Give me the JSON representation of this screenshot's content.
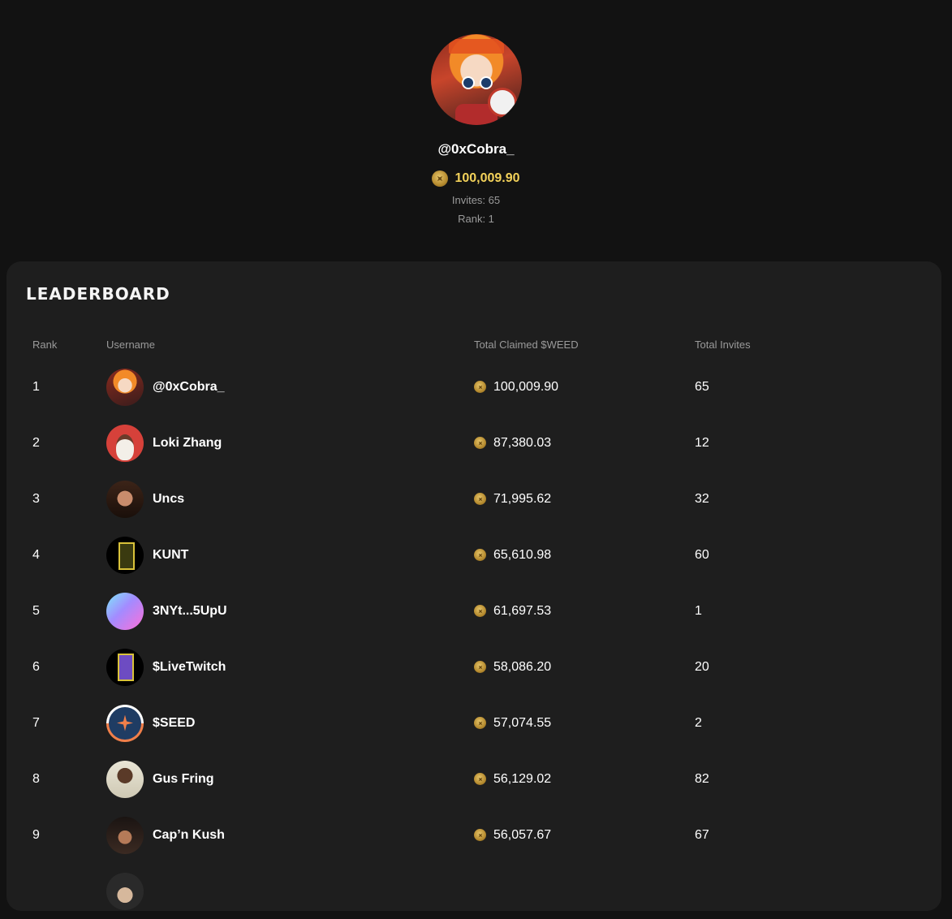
{
  "profile": {
    "username": "@0xCobra_",
    "balance": "100,009.90",
    "invites": "Invites: 65",
    "rank": "Rank: 1",
    "avatar_icon": "anime-girl-avatar",
    "balance_icon": "weed-coin-icon"
  },
  "leaderboard": {
    "title": "LEADERBOARD",
    "columns": {
      "rank": "Rank",
      "username": "Username",
      "claimed": "Total Claimed $WEED",
      "invites": "Total Invites"
    },
    "rows": [
      {
        "rank": "1",
        "username": "@0xCobra_",
        "claimed": "100,009.90",
        "invites": "65"
      },
      {
        "rank": "2",
        "username": "Loki Zhang",
        "claimed": "87,380.03",
        "invites": "12"
      },
      {
        "rank": "3",
        "username": "Uncs",
        "claimed": "71,995.62",
        "invites": "32"
      },
      {
        "rank": "4",
        "username": "KUNT",
        "claimed": "65,610.98",
        "invites": "60"
      },
      {
        "rank": "5",
        "username": "3NYt...5UpU",
        "claimed": "61,697.53",
        "invites": "1"
      },
      {
        "rank": "6",
        "username": "$LiveTwitch",
        "claimed": "58,086.20",
        "invites": "20"
      },
      {
        "rank": "7",
        "username": "$SEED",
        "claimed": "57,074.55",
        "invites": "2"
      },
      {
        "rank": "8",
        "username": "Gus Fring",
        "claimed": "56,129.02",
        "invites": "82"
      },
      {
        "rank": "9",
        "username": "Cap’n Kush",
        "claimed": "56,057.67",
        "invites": "67"
      }
    ]
  },
  "colors": {
    "background": "#121212",
    "panel": "#1e1e1e",
    "accent_gold": "#f2d15a",
    "muted_text": "#9a9a9a"
  }
}
